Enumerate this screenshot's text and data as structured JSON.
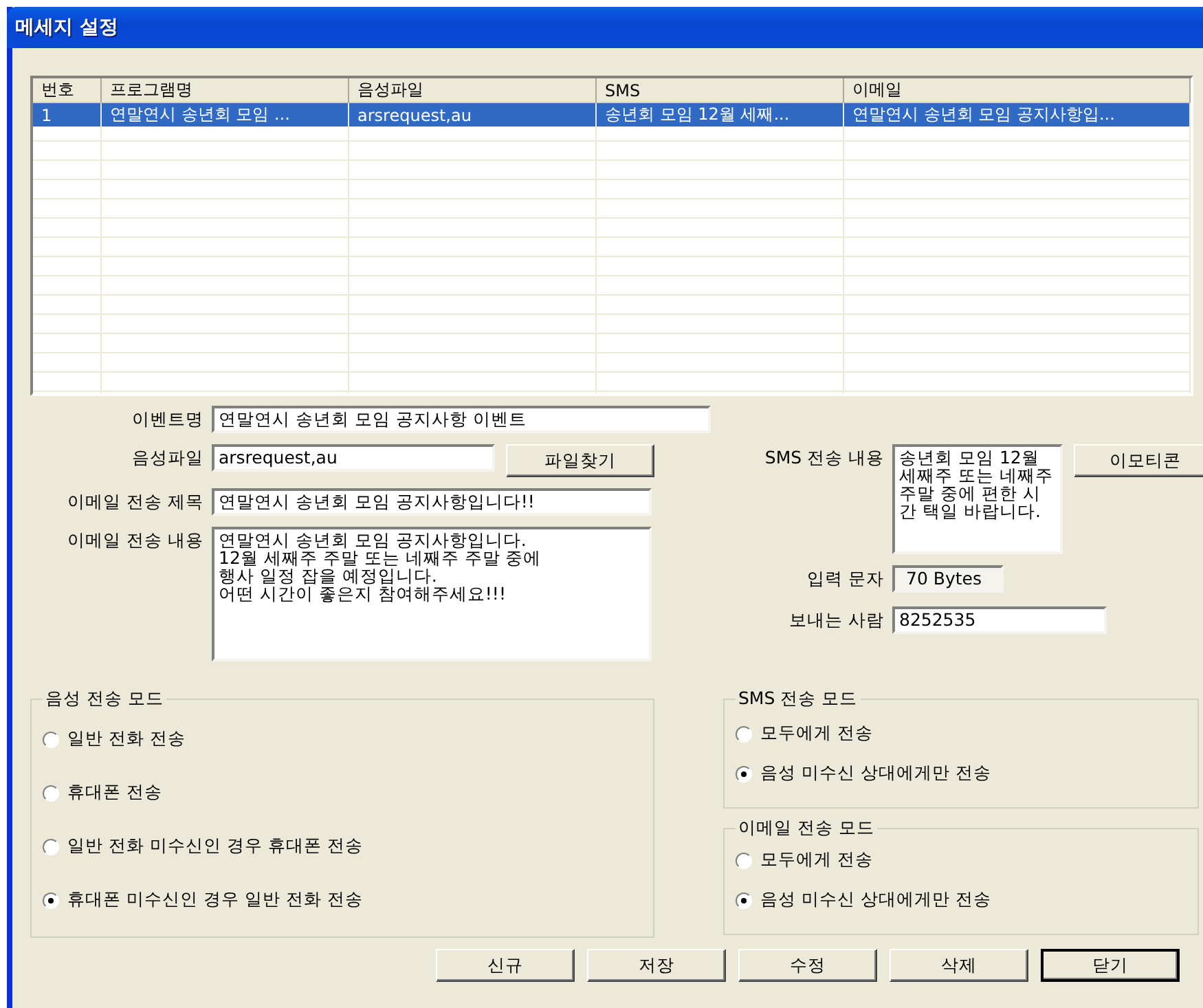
{
  "window": {
    "title": "메세지 설정"
  },
  "table": {
    "columns": [
      "번호",
      "프로그램명",
      "음성파일",
      "SMS",
      "이메일"
    ],
    "rows": [
      {
        "selected": true,
        "cells": [
          "1",
          "연말연시 송년회 모임 ...",
          "arsrequest,au",
          "송년회 모임 12월 세째...",
          "연말연시 송년회 모임 공지사항입..."
        ]
      }
    ]
  },
  "form": {
    "event_name": {
      "label": "이벤트명",
      "value": "연말연시 송년회 모임 공지사항 이벤트"
    },
    "sound_file": {
      "label": "음성파일",
      "value": "arsrequest,au",
      "button": "파일찾기"
    },
    "email_subject": {
      "label": "이메일 전송 제목",
      "value": "연말연시 송년회 모임 공지사항입니다!!"
    },
    "email_body": {
      "label": "이메일 전송 내용",
      "value": "연말연시 송년회 모임 공지사항입니다.\n12월 세째주 주말 또는 네째주 주말 중에\n행사 일정 잡을 예정입니다.\n어떤 시간이 좋은지 참여해주세요!!!"
    },
    "sms_body": {
      "label": "SMS 전송 내용",
      "value": "송년회 모임 12월 세째주 또는 네째주 주말 중에 편한 시간 택일 바랍니다.",
      "button": "이모티콘"
    },
    "input_chars": {
      "label": "입력 문자",
      "value": "70 Bytes"
    },
    "sender": {
      "label": "보내는 사람",
      "value": "8252535"
    }
  },
  "voice_mode": {
    "title": "음성 전송 모드",
    "options": [
      {
        "label": "일반 전화 전송",
        "selected": false
      },
      {
        "label": "휴대폰 전송",
        "selected": false
      },
      {
        "label": "일반 전화 미수신인 경우 휴대폰 전송",
        "selected": false
      },
      {
        "label": "휴대폰 미수신인 경우 일반 전화 전송",
        "selected": true
      }
    ]
  },
  "sms_mode": {
    "title": "SMS 전송 모드",
    "options": [
      {
        "label": "모두에게 전송",
        "selected": false
      },
      {
        "label": "음성 미수신 상대에게만 전송",
        "selected": true
      }
    ]
  },
  "email_mode": {
    "title": "이메일 전송 모드",
    "options": [
      {
        "label": "모두에게 전송",
        "selected": false
      },
      {
        "label": "음성 미수신 상대에게만 전송",
        "selected": true
      }
    ]
  },
  "buttons": [
    {
      "label": "신규",
      "default": false
    },
    {
      "label": "저장",
      "default": false
    },
    {
      "label": "수정",
      "default": false
    },
    {
      "label": "삭제",
      "default": false
    },
    {
      "label": "닫기",
      "default": true
    }
  ]
}
